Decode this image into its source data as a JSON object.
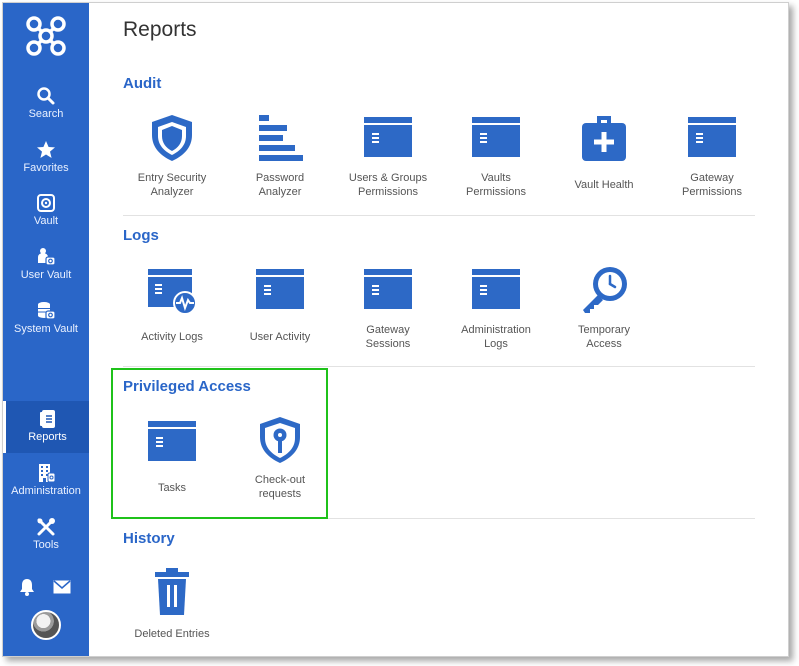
{
  "sidebar": {
    "logo_icon": "devolutions-logo-icon",
    "items": [
      {
        "label": "Search",
        "icon": "search-icon"
      },
      {
        "label": "Favorites",
        "icon": "star-icon"
      },
      {
        "label": "Vault",
        "icon": "vault-icon"
      },
      {
        "label": "User Vault",
        "icon": "user-vault-icon"
      },
      {
        "label": "System Vault",
        "icon": "system-vault-icon"
      },
      {
        "label": "Reports",
        "icon": "reports-icon",
        "active": true
      },
      {
        "label": "Administration",
        "icon": "building-icon"
      },
      {
        "label": "Tools",
        "icon": "tools-icon"
      }
    ],
    "bottom_icons": [
      "bell-icon",
      "mail-icon"
    ]
  },
  "page_title": "Reports",
  "sections": {
    "audit": {
      "title": "Audit",
      "tiles": [
        {
          "label": "Entry Security\nAnalyzer",
          "icon": "shield-icon"
        },
        {
          "label": "Password\nAnalyzer",
          "icon": "bars-icon"
        },
        {
          "label": "Users & Groups\nPermissions",
          "icon": "window-list-icon"
        },
        {
          "label": "Vaults\nPermissions",
          "icon": "window-list-icon"
        },
        {
          "label": "Vault Health",
          "icon": "first-aid-kit-icon"
        },
        {
          "label": "Gateway\nPermissions",
          "icon": "window-list-icon"
        }
      ]
    },
    "logs": {
      "title": "Logs",
      "tiles": [
        {
          "label": "Activity Logs",
          "icon": "window-activity-icon"
        },
        {
          "label": "User Activity",
          "icon": "window-list-icon"
        },
        {
          "label": "Gateway\nSessions",
          "icon": "window-list-icon"
        },
        {
          "label": "Administration\nLogs",
          "icon": "window-list-icon"
        },
        {
          "label": "Temporary\nAccess",
          "icon": "key-clock-icon"
        }
      ]
    },
    "privileged": {
      "title": "Privileged Access",
      "tiles": [
        {
          "label": "Tasks",
          "icon": "window-list-icon"
        },
        {
          "label": "Check-out\nrequests",
          "icon": "shield-key-icon"
        }
      ]
    },
    "history": {
      "title": "History",
      "tiles": [
        {
          "label": "Deleted Entries",
          "icon": "trash-icon"
        }
      ]
    }
  },
  "colors": {
    "sidebar": "#2a66c8",
    "accent": "#2a66c8",
    "icon_blue": "#2d69c6",
    "highlight": "#1fc21a"
  }
}
